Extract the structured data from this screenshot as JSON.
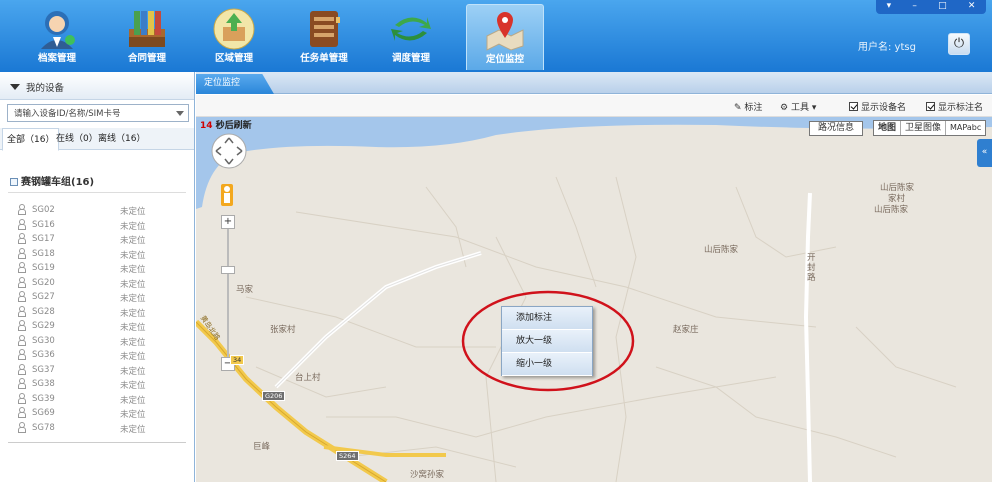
{
  "nav": {
    "items": [
      {
        "label": "档案管理",
        "icon": "user-profile-icon"
      },
      {
        "label": "合同管理",
        "icon": "binders-icon"
      },
      {
        "label": "区域管理",
        "icon": "region-box-icon"
      },
      {
        "label": "任务单管理",
        "icon": "notebook-icon"
      },
      {
        "label": "调度管理",
        "icon": "refresh-arrows-icon"
      },
      {
        "label": "定位监控",
        "icon": "map-pin-icon"
      }
    ],
    "active_index": 5
  },
  "user": {
    "label": "用户名: ytsg"
  },
  "window_controls": {
    "dropdown": "▾",
    "minimize": "–",
    "maximize": "□",
    "close": "✕"
  },
  "left_panel": {
    "title": "我的设备",
    "search_placeholder": "请输入设备ID/名称/SIM卡号",
    "tabs": [
      "全部（16）",
      "在线（0）",
      "离线（16）"
    ],
    "group_name": "赛钢罐车组(16)",
    "devices": [
      {
        "name": "SG02",
        "status": "未定位"
      },
      {
        "name": "SG16",
        "status": "未定位"
      },
      {
        "name": "SG17",
        "status": "未定位"
      },
      {
        "name": "SG18",
        "status": "未定位"
      },
      {
        "name": "SG19",
        "status": "未定位"
      },
      {
        "name": "SG20",
        "status": "未定位"
      },
      {
        "name": "SG27",
        "status": "未定位"
      },
      {
        "name": "SG28",
        "status": "未定位"
      },
      {
        "name": "SG29",
        "status": "未定位"
      },
      {
        "name": "SG30",
        "status": "未定位"
      },
      {
        "name": "SG36",
        "status": "未定位"
      },
      {
        "name": "SG37",
        "status": "未定位"
      },
      {
        "name": "SG38",
        "status": "未定位"
      },
      {
        "name": "SG39",
        "status": "未定位"
      },
      {
        "name": "SG69",
        "status": "未定位"
      },
      {
        "name": "SG78",
        "status": "未定位"
      }
    ]
  },
  "tabbar": {
    "active_tab": "定位监控"
  },
  "toolbar": {
    "mark": "标注",
    "tools": "工具",
    "show_device_names": "显示设备名",
    "show_mark_names": "显示标注名"
  },
  "map": {
    "refresh_seconds": "14",
    "refresh_text": " 秒后刷新",
    "route_button": "路况信息",
    "map_types": [
      "地图",
      "卫星图像",
      "MAPabc"
    ],
    "zoom_in": "+",
    "zoom_out": "−",
    "places": [
      "山后陈家",
      "家村",
      "山后陈家",
      "山后陈家",
      "开",
      "封",
      "路",
      "马家",
      "张家村",
      "赵家庄",
      "台上村",
      "巨峰",
      "沙窝孙家",
      "黄岛北路"
    ],
    "road_shields": [
      "G206",
      "S264",
      "34"
    ]
  },
  "context_menu": {
    "items": [
      "添加标注",
      "放大一级",
      "缩小一级"
    ]
  },
  "colors": {
    "topbar": "#2a8ae0",
    "highlight_circle": "#d0121b",
    "water": "#a4c6eb",
    "road_major": "#f2c94c"
  }
}
